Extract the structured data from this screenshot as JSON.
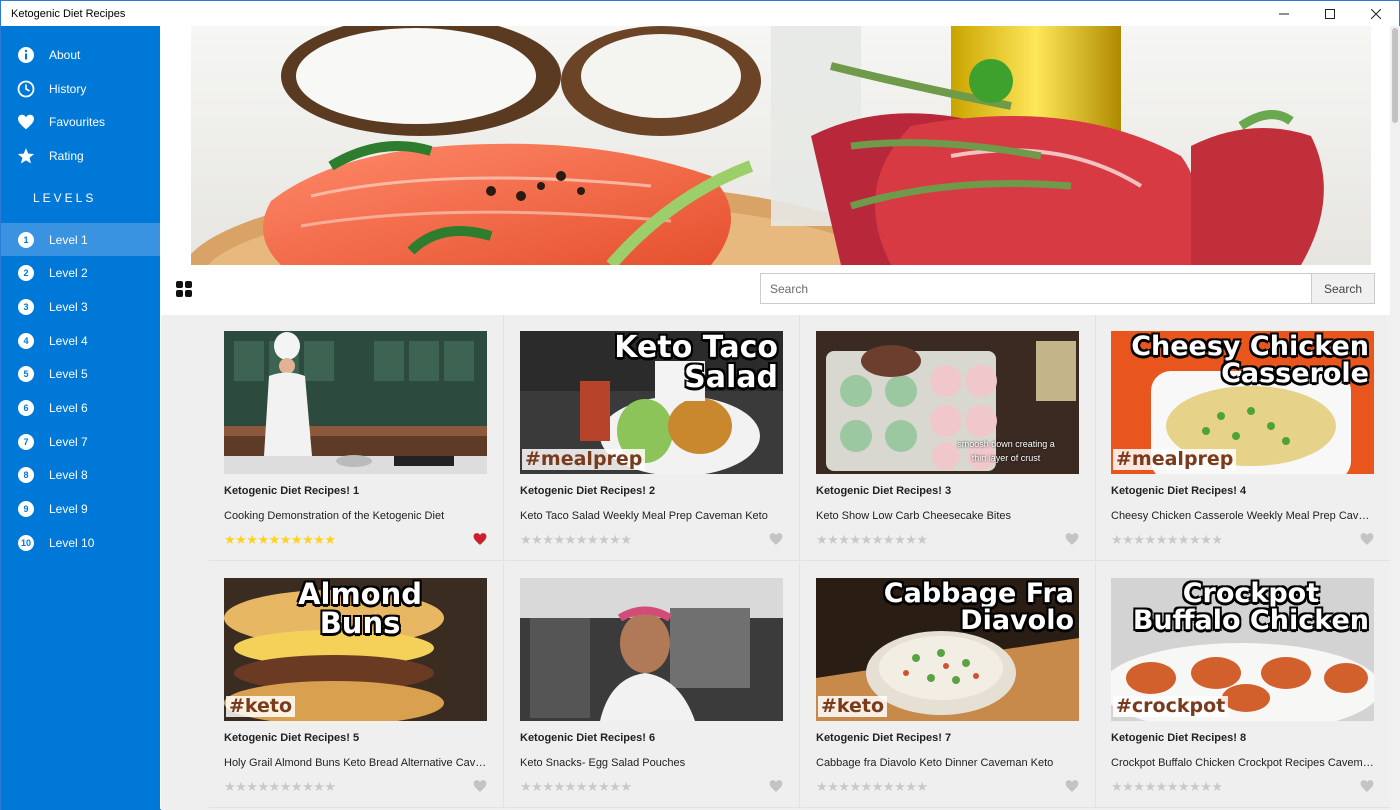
{
  "window": {
    "title": "Ketogenic Diet Recipes",
    "minimize_icon": "minimize-icon",
    "maximize_icon": "maximize-icon",
    "close_icon": "close-icon"
  },
  "nav": [
    {
      "label": "About",
      "icon": "info-icon"
    },
    {
      "label": "History",
      "icon": "clock-icon"
    },
    {
      "label": "Favourites",
      "icon": "heart-icon"
    },
    {
      "label": "Rating",
      "icon": "star-icon"
    }
  ],
  "levels_header": "LEVELS",
  "levels": [
    {
      "num": "1",
      "label": "Level 1"
    },
    {
      "num": "2",
      "label": "Level 2"
    },
    {
      "num": "3",
      "label": "Level 3"
    },
    {
      "num": "4",
      "label": "Level 4"
    },
    {
      "num": "5",
      "label": "Level 5"
    },
    {
      "num": "6",
      "label": "Level 6"
    },
    {
      "num": "7",
      "label": "Level 7"
    },
    {
      "num": "8",
      "label": "Level 8"
    },
    {
      "num": "9",
      "label": "Level 9"
    },
    {
      "num": "10",
      "label": "Level 10"
    }
  ],
  "active_level": "Level 1",
  "search": {
    "placeholder": "Search",
    "button_label": "Search"
  },
  "colors": {
    "sidebar": "#0078d7",
    "sidebar_active": "#3a93e0",
    "star_filled": "#ffd21f",
    "star_empty": "#c9c9c9",
    "heart_active": "#cc1f2d",
    "heart_inactive": "#c4c4c4"
  },
  "recipes": [
    {
      "title": "Ketogenic Diet Recipes! 1",
      "desc": "Cooking Demonstration of the Ketogenic Diet",
      "thumb_text": [],
      "tag": "",
      "stars": "★★★★★★★★★★",
      "rating": 10,
      "favourite": true
    },
    {
      "title": "Ketogenic Diet Recipes! 2",
      "desc": "Keto Taco Salad Weekly Meal Prep Caveman Keto",
      "thumb_text": [
        "Keto Taco Salad"
      ],
      "tag": "#mealprep",
      "stars": "★★★★★★★★★★",
      "rating": 0,
      "favourite": false
    },
    {
      "title": "Ketogenic Diet Recipes! 3",
      "desc": "Keto Show Low Carb Cheesecake Bites",
      "thumb_text": [],
      "tag": "",
      "thumb_caption": "smoosh down creating a thin layer of crust",
      "stars": "★★★★★★★★★★",
      "rating": 0,
      "favourite": false
    },
    {
      "title": "Ketogenic Diet Recipes! 4",
      "desc": "Cheesy Chicken Casserole Weekly Meal Prep Caveman Keto",
      "thumb_text": [
        "Cheesy Chicken",
        "Casserole"
      ],
      "tag": "#mealprep",
      "stars": "★★★★★★★★★★",
      "rating": 0,
      "favourite": false
    },
    {
      "title": "Ketogenic Diet Recipes! 5",
      "desc": "Holy Grail Almond Buns Keto Bread Alternative Caveman Keto",
      "thumb_text": [
        "Almond",
        "Buns"
      ],
      "tag": "#keto",
      "stars": "★★★★★★★★★★",
      "rating": 0,
      "favourite": false
    },
    {
      "title": "Ketogenic Diet Recipes! 6",
      "desc": "Keto Snacks- Egg Salad Pouches",
      "thumb_text": [],
      "tag": "",
      "stars": "★★★★★★★★★★",
      "rating": 0,
      "favourite": false
    },
    {
      "title": "Ketogenic Diet Recipes! 7",
      "desc": "Cabbage fra Diavolo Keto Dinner Caveman Keto",
      "thumb_text": [
        "Cabbage Fra",
        "Diavolo"
      ],
      "tag": "#keto",
      "stars": "★★★★★★★★★★",
      "rating": 0,
      "favourite": false
    },
    {
      "title": "Ketogenic Diet Recipes! 8",
      "desc": "Crockpot Buffalo Chicken Crockpot Recipes Caveman Keto",
      "thumb_text": [
        "Crockpot",
        "Buffalo Chicken"
      ],
      "tag": "#crockpot",
      "stars": "★★★★★★★★★★",
      "rating": 0,
      "favourite": false
    }
  ]
}
